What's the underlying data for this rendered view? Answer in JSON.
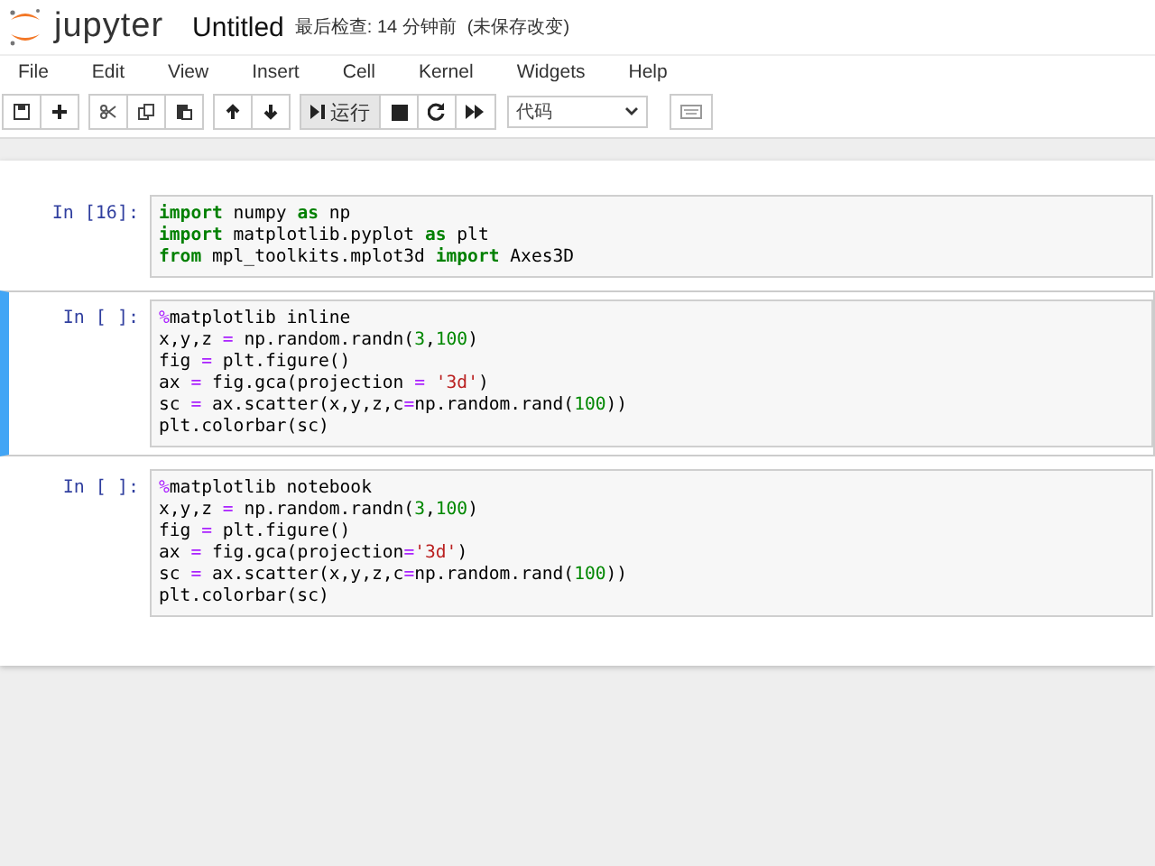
{
  "header": {
    "logo": "jupyter",
    "title": "Untitled",
    "checkpoint": "最后检查: 14 分钟前",
    "save_status": "(未保存改变)"
  },
  "menu": [
    "File",
    "Edit",
    "View",
    "Insert",
    "Cell",
    "Kernel",
    "Widgets",
    "Help"
  ],
  "toolbar": {
    "groups": [
      [
        {
          "kind": "save"
        },
        {
          "kind": "plus"
        }
      ],
      [
        {
          "kind": "cut"
        },
        {
          "kind": "copy"
        },
        {
          "kind": "paste"
        }
      ],
      [
        {
          "kind": "up"
        },
        {
          "kind": "down"
        }
      ],
      [
        {
          "kind": "run",
          "label": "运行"
        },
        {
          "kind": "stop"
        },
        {
          "kind": "restart"
        },
        {
          "kind": "forward"
        }
      ]
    ],
    "cell_type": "代码"
  },
  "cells": [
    {
      "prompt": "In [16]:",
      "selected": false,
      "lines": [
        [
          {
            "text": "import",
            "kind": "kw"
          },
          {
            "text": " numpy ",
            "kind": "plain"
          },
          {
            "text": "as",
            "kind": "kw"
          },
          {
            "text": " np",
            "kind": "plain"
          }
        ],
        [
          {
            "text": "import",
            "kind": "kw"
          },
          {
            "text": " matplotlib.pyplot ",
            "kind": "plain"
          },
          {
            "text": "as",
            "kind": "kw"
          },
          {
            "text": " plt",
            "kind": "plain"
          }
        ],
        [
          {
            "text": "from",
            "kind": "kw"
          },
          {
            "text": " mpl_toolkits.mplot3d ",
            "kind": "plain"
          },
          {
            "text": "import",
            "kind": "kw"
          },
          {
            "text": " Axes3D",
            "kind": "plain"
          }
        ]
      ]
    },
    {
      "prompt": "In [ ]:",
      "selected": true,
      "lines": [
        [
          {
            "text": "%",
            "kind": "op"
          },
          {
            "text": "matplotlib inline",
            "kind": "plain"
          }
        ],
        [
          {
            "text": "x,y,z ",
            "kind": "plain"
          },
          {
            "text": "=",
            "kind": "op"
          },
          {
            "text": " np.random.randn(",
            "kind": "plain"
          },
          {
            "text": "3",
            "kind": "num"
          },
          {
            "text": ",",
            "kind": "plain"
          },
          {
            "text": "100",
            "kind": "num"
          },
          {
            "text": ")",
            "kind": "plain"
          }
        ],
        [
          {
            "text": "fig ",
            "kind": "plain"
          },
          {
            "text": "=",
            "kind": "op"
          },
          {
            "text": " plt.figure()",
            "kind": "plain"
          }
        ],
        [
          {
            "text": "ax ",
            "kind": "plain"
          },
          {
            "text": "=",
            "kind": "op"
          },
          {
            "text": " fig.gca(projection ",
            "kind": "plain"
          },
          {
            "text": "= ",
            "kind": "op"
          },
          {
            "text": "'3d'",
            "kind": "str"
          },
          {
            "text": ")",
            "kind": "plain"
          }
        ],
        [
          {
            "text": "sc ",
            "kind": "plain"
          },
          {
            "text": "=",
            "kind": "op"
          },
          {
            "text": " ax.scatter(x,y,z,c",
            "kind": "plain"
          },
          {
            "text": "=",
            "kind": "op"
          },
          {
            "text": "np.random.rand(",
            "kind": "plain"
          },
          {
            "text": "100",
            "kind": "num"
          },
          {
            "text": "))",
            "kind": "plain"
          }
        ],
        [
          {
            "text": "plt.colorbar(sc)",
            "kind": "plain"
          }
        ]
      ]
    },
    {
      "prompt": "In [ ]:",
      "selected": false,
      "lines": [
        [
          {
            "text": "%",
            "kind": "op"
          },
          {
            "text": "matplotlib notebook",
            "kind": "plain"
          }
        ],
        [
          {
            "text": "x,y,z ",
            "kind": "plain"
          },
          {
            "text": "=",
            "kind": "op"
          },
          {
            "text": " np.random.randn(",
            "kind": "plain"
          },
          {
            "text": "3",
            "kind": "num"
          },
          {
            "text": ",",
            "kind": "plain"
          },
          {
            "text": "100",
            "kind": "num"
          },
          {
            "text": ")",
            "kind": "plain"
          }
        ],
        [
          {
            "text": "fig ",
            "kind": "plain"
          },
          {
            "text": "=",
            "kind": "op"
          },
          {
            "text": " plt.figure()",
            "kind": "plain"
          }
        ],
        [
          {
            "text": "ax ",
            "kind": "plain"
          },
          {
            "text": "=",
            "kind": "op"
          },
          {
            "text": " fig.gca(projection",
            "kind": "plain"
          },
          {
            "text": "=",
            "kind": "op"
          },
          {
            "text": "'3d'",
            "kind": "str"
          },
          {
            "text": ")",
            "kind": "plain"
          }
        ],
        [
          {
            "text": "sc ",
            "kind": "plain"
          },
          {
            "text": "=",
            "kind": "op"
          },
          {
            "text": " ax.scatter(x,y,z,c",
            "kind": "plain"
          },
          {
            "text": "=",
            "kind": "op"
          },
          {
            "text": "np.random.rand(",
            "kind": "plain"
          },
          {
            "text": "100",
            "kind": "num"
          },
          {
            "text": "))",
            "kind": "plain"
          }
        ],
        [
          {
            "text": "plt.colorbar(sc)",
            "kind": "plain"
          }
        ]
      ]
    }
  ]
}
